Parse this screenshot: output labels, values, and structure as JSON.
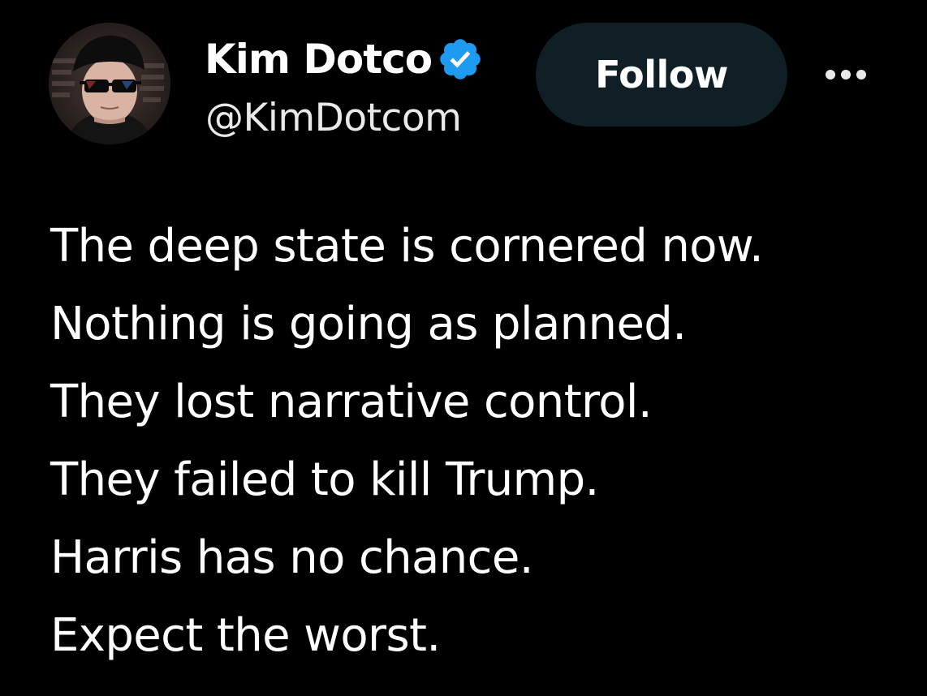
{
  "user": {
    "display_name": "Kim Dotco",
    "handle": "@KimDotcom",
    "verified": true,
    "verified_color": "#1d9bf0",
    "avatar_icon": "profile-photo"
  },
  "actions": {
    "follow_label": "Follow",
    "more_icon": "ellipsis-icon"
  },
  "tweet": {
    "lines": [
      "The deep state is cornered now.",
      "Nothing is going as planned.",
      "They lost narrative control.",
      "They failed to kill Trump.",
      "Harris has no chance.",
      "Expect the worst."
    ]
  },
  "colors": {
    "background": "#000000",
    "text": "#ffffff",
    "follow_button_bg": "#0f1f25"
  }
}
